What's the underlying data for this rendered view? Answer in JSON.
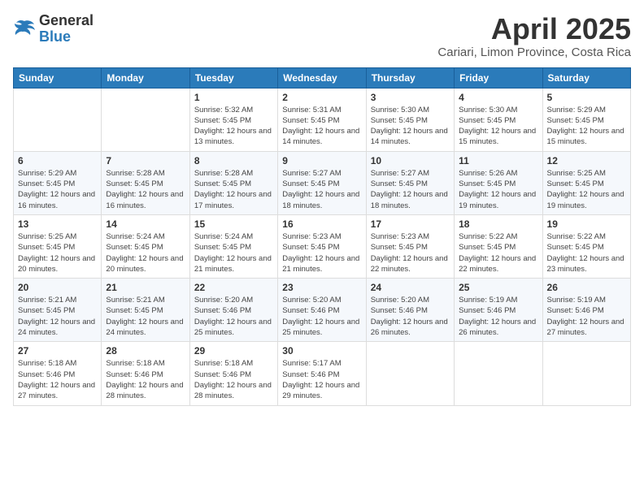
{
  "logo": {
    "text_general": "General",
    "text_blue": "Blue"
  },
  "header": {
    "month_title": "April 2025",
    "location": "Cariari, Limon Province, Costa Rica"
  },
  "weekdays": [
    "Sunday",
    "Monday",
    "Tuesday",
    "Wednesday",
    "Thursday",
    "Friday",
    "Saturday"
  ],
  "weeks": [
    [
      {
        "day": "",
        "sunrise": "",
        "sunset": "",
        "daylight": ""
      },
      {
        "day": "",
        "sunrise": "",
        "sunset": "",
        "daylight": ""
      },
      {
        "day": "1",
        "sunrise": "Sunrise: 5:32 AM",
        "sunset": "Sunset: 5:45 PM",
        "daylight": "Daylight: 12 hours and 13 minutes."
      },
      {
        "day": "2",
        "sunrise": "Sunrise: 5:31 AM",
        "sunset": "Sunset: 5:45 PM",
        "daylight": "Daylight: 12 hours and 14 minutes."
      },
      {
        "day": "3",
        "sunrise": "Sunrise: 5:30 AM",
        "sunset": "Sunset: 5:45 PM",
        "daylight": "Daylight: 12 hours and 14 minutes."
      },
      {
        "day": "4",
        "sunrise": "Sunrise: 5:30 AM",
        "sunset": "Sunset: 5:45 PM",
        "daylight": "Daylight: 12 hours and 15 minutes."
      },
      {
        "day": "5",
        "sunrise": "Sunrise: 5:29 AM",
        "sunset": "Sunset: 5:45 PM",
        "daylight": "Daylight: 12 hours and 15 minutes."
      }
    ],
    [
      {
        "day": "6",
        "sunrise": "Sunrise: 5:29 AM",
        "sunset": "Sunset: 5:45 PM",
        "daylight": "Daylight: 12 hours and 16 minutes."
      },
      {
        "day": "7",
        "sunrise": "Sunrise: 5:28 AM",
        "sunset": "Sunset: 5:45 PM",
        "daylight": "Daylight: 12 hours and 16 minutes."
      },
      {
        "day": "8",
        "sunrise": "Sunrise: 5:28 AM",
        "sunset": "Sunset: 5:45 PM",
        "daylight": "Daylight: 12 hours and 17 minutes."
      },
      {
        "day": "9",
        "sunrise": "Sunrise: 5:27 AM",
        "sunset": "Sunset: 5:45 PM",
        "daylight": "Daylight: 12 hours and 18 minutes."
      },
      {
        "day": "10",
        "sunrise": "Sunrise: 5:27 AM",
        "sunset": "Sunset: 5:45 PM",
        "daylight": "Daylight: 12 hours and 18 minutes."
      },
      {
        "day": "11",
        "sunrise": "Sunrise: 5:26 AM",
        "sunset": "Sunset: 5:45 PM",
        "daylight": "Daylight: 12 hours and 19 minutes."
      },
      {
        "day": "12",
        "sunrise": "Sunrise: 5:25 AM",
        "sunset": "Sunset: 5:45 PM",
        "daylight": "Daylight: 12 hours and 19 minutes."
      }
    ],
    [
      {
        "day": "13",
        "sunrise": "Sunrise: 5:25 AM",
        "sunset": "Sunset: 5:45 PM",
        "daylight": "Daylight: 12 hours and 20 minutes."
      },
      {
        "day": "14",
        "sunrise": "Sunrise: 5:24 AM",
        "sunset": "Sunset: 5:45 PM",
        "daylight": "Daylight: 12 hours and 20 minutes."
      },
      {
        "day": "15",
        "sunrise": "Sunrise: 5:24 AM",
        "sunset": "Sunset: 5:45 PM",
        "daylight": "Daylight: 12 hours and 21 minutes."
      },
      {
        "day": "16",
        "sunrise": "Sunrise: 5:23 AM",
        "sunset": "Sunset: 5:45 PM",
        "daylight": "Daylight: 12 hours and 21 minutes."
      },
      {
        "day": "17",
        "sunrise": "Sunrise: 5:23 AM",
        "sunset": "Sunset: 5:45 PM",
        "daylight": "Daylight: 12 hours and 22 minutes."
      },
      {
        "day": "18",
        "sunrise": "Sunrise: 5:22 AM",
        "sunset": "Sunset: 5:45 PM",
        "daylight": "Daylight: 12 hours and 22 minutes."
      },
      {
        "day": "19",
        "sunrise": "Sunrise: 5:22 AM",
        "sunset": "Sunset: 5:45 PM",
        "daylight": "Daylight: 12 hours and 23 minutes."
      }
    ],
    [
      {
        "day": "20",
        "sunrise": "Sunrise: 5:21 AM",
        "sunset": "Sunset: 5:45 PM",
        "daylight": "Daylight: 12 hours and 24 minutes."
      },
      {
        "day": "21",
        "sunrise": "Sunrise: 5:21 AM",
        "sunset": "Sunset: 5:45 PM",
        "daylight": "Daylight: 12 hours and 24 minutes."
      },
      {
        "day": "22",
        "sunrise": "Sunrise: 5:20 AM",
        "sunset": "Sunset: 5:46 PM",
        "daylight": "Daylight: 12 hours and 25 minutes."
      },
      {
        "day": "23",
        "sunrise": "Sunrise: 5:20 AM",
        "sunset": "Sunset: 5:46 PM",
        "daylight": "Daylight: 12 hours and 25 minutes."
      },
      {
        "day": "24",
        "sunrise": "Sunrise: 5:20 AM",
        "sunset": "Sunset: 5:46 PM",
        "daylight": "Daylight: 12 hours and 26 minutes."
      },
      {
        "day": "25",
        "sunrise": "Sunrise: 5:19 AM",
        "sunset": "Sunset: 5:46 PM",
        "daylight": "Daylight: 12 hours and 26 minutes."
      },
      {
        "day": "26",
        "sunrise": "Sunrise: 5:19 AM",
        "sunset": "Sunset: 5:46 PM",
        "daylight": "Daylight: 12 hours and 27 minutes."
      }
    ],
    [
      {
        "day": "27",
        "sunrise": "Sunrise: 5:18 AM",
        "sunset": "Sunset: 5:46 PM",
        "daylight": "Daylight: 12 hours and 27 minutes."
      },
      {
        "day": "28",
        "sunrise": "Sunrise: 5:18 AM",
        "sunset": "Sunset: 5:46 PM",
        "daylight": "Daylight: 12 hours and 28 minutes."
      },
      {
        "day": "29",
        "sunrise": "Sunrise: 5:18 AM",
        "sunset": "Sunset: 5:46 PM",
        "daylight": "Daylight: 12 hours and 28 minutes."
      },
      {
        "day": "30",
        "sunrise": "Sunrise: 5:17 AM",
        "sunset": "Sunset: 5:46 PM",
        "daylight": "Daylight: 12 hours and 29 minutes."
      },
      {
        "day": "",
        "sunrise": "",
        "sunset": "",
        "daylight": ""
      },
      {
        "day": "",
        "sunrise": "",
        "sunset": "",
        "daylight": ""
      },
      {
        "day": "",
        "sunrise": "",
        "sunset": "",
        "daylight": ""
      }
    ]
  ]
}
